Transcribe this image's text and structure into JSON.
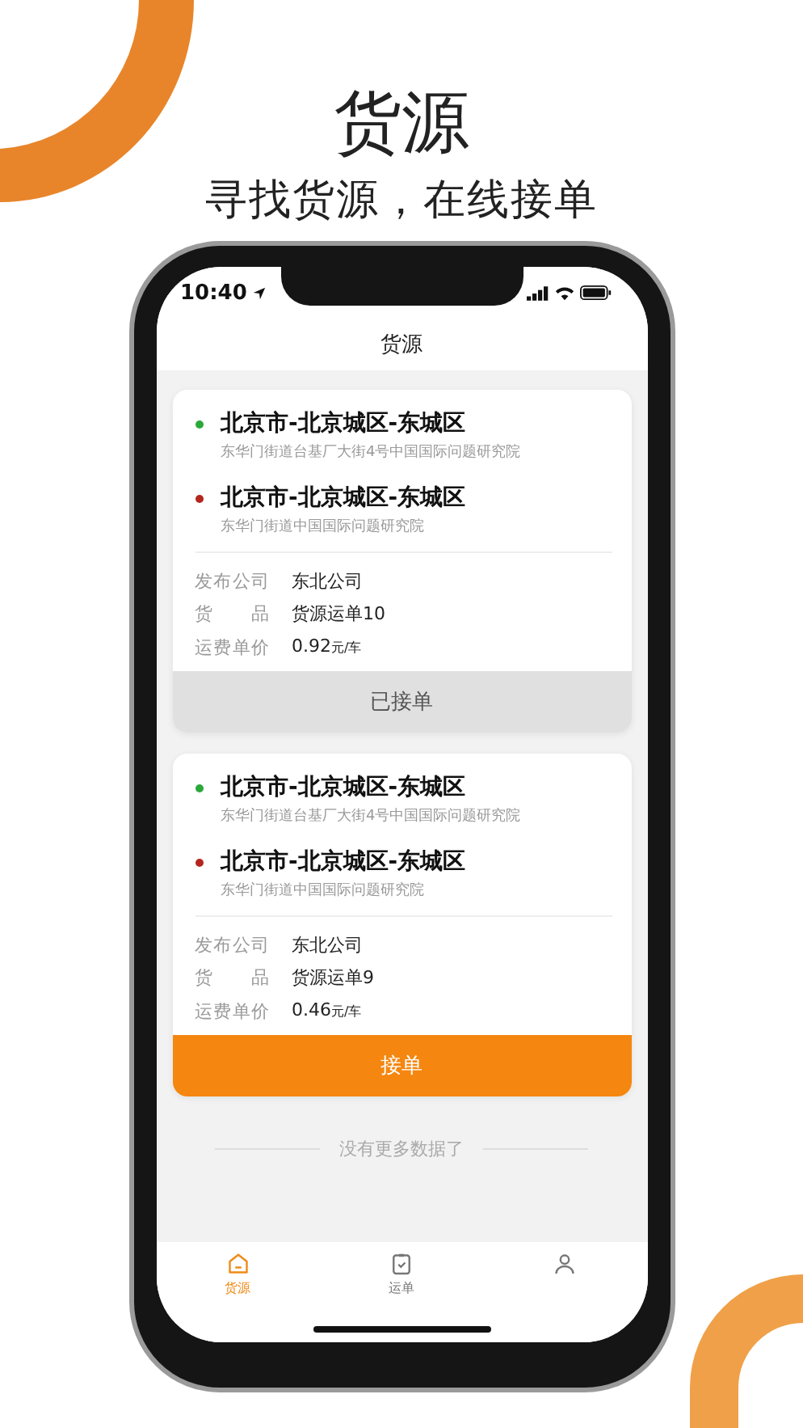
{
  "hero": {
    "title": "货源",
    "subtitle": "寻找货源，在线接单"
  },
  "status_bar": {
    "time": "10:40"
  },
  "nav": {
    "title": "货源"
  },
  "orders": [
    {
      "from": {
        "city": "北京市-北京城区-东城区",
        "address": "东华门街道台基厂大街4号中国国际问题研究院"
      },
      "to": {
        "city": "北京市-北京城区-东城区",
        "address": "东华门街道中国国际问题研究院"
      },
      "fields": [
        {
          "label": "发布公司",
          "value": "东北公司"
        },
        {
          "label": "货品",
          "value": "货源运单10"
        }
      ],
      "price": {
        "label": "运费单价",
        "value": "0.92",
        "unit": "元/车"
      },
      "action": {
        "label": "已接单",
        "kind": "taken"
      }
    },
    {
      "from": {
        "city": "北京市-北京城区-东城区",
        "address": "东华门街道台基厂大街4号中国国际问题研究院"
      },
      "to": {
        "city": "北京市-北京城区-东城区",
        "address": "东华门街道中国国际问题研究院"
      },
      "fields": [
        {
          "label": "发布公司",
          "value": "东北公司"
        },
        {
          "label": "货品",
          "value": "货源运单9"
        }
      ],
      "price": {
        "label": "运费单价",
        "value": "0.46",
        "unit": "元/车"
      },
      "action": {
        "label": "接单",
        "kind": "accept"
      }
    }
  ],
  "footer": "没有更多数据了",
  "tabs": [
    {
      "kind": "home",
      "label": "货源",
      "selected": true
    },
    {
      "kind": "orders",
      "label": "运单",
      "selected": false
    },
    {
      "kind": "account",
      "selected": false
    }
  ]
}
